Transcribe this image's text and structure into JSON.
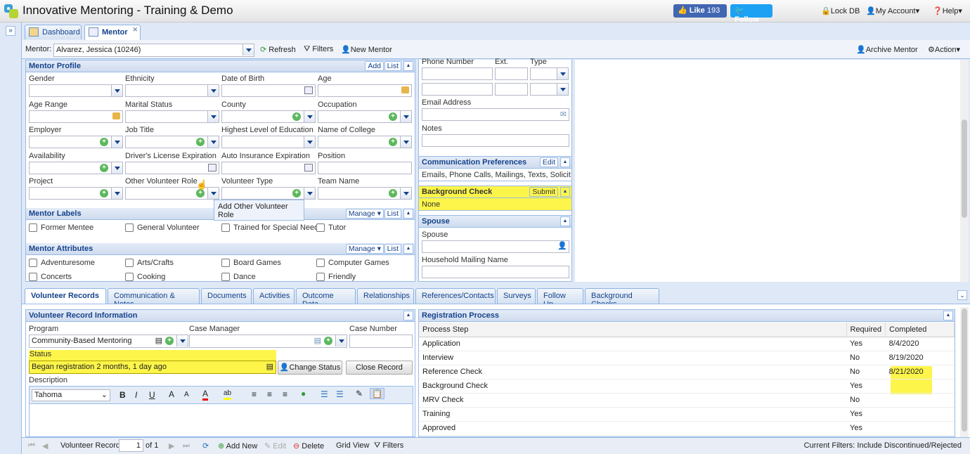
{
  "app": {
    "title": "Innovative Mentoring - Training & Demo"
  },
  "header": {
    "like_label": "Like",
    "like_count": "193",
    "follow_label": "Follow",
    "lock_db": "Lock DB",
    "my_account": "My Account",
    "help": "Help"
  },
  "tabs": [
    {
      "label": "Dashboard"
    },
    {
      "label": "Mentor"
    }
  ],
  "toolbar": {
    "mentor_label": "Mentor:",
    "mentor_value": "Alvarez, Jessica (10246)",
    "refresh": "Refresh",
    "filters": "Filters",
    "new_mentor": "New Mentor",
    "archive": "Archive Mentor",
    "action": "Action"
  },
  "profile": {
    "title": "Mentor Profile",
    "add": "Add",
    "list": "List",
    "fields": [
      {
        "label": "Gender",
        "type": "select"
      },
      {
        "label": "Ethnicity",
        "type": "select"
      },
      {
        "label": "Date of Birth",
        "type": "date"
      },
      {
        "label": "Age",
        "type": "lock"
      },
      {
        "label": "Age Range",
        "type": "lock"
      },
      {
        "label": "Marital Status",
        "type": "select"
      },
      {
        "label": "County",
        "type": "plus"
      },
      {
        "label": "Occupation",
        "type": "plus"
      },
      {
        "label": "Employer",
        "type": "plus"
      },
      {
        "label": "Job Title",
        "type": "plus"
      },
      {
        "label": "Highest Level of Education",
        "type": "select"
      },
      {
        "label": "Name of College",
        "type": "plus"
      },
      {
        "label": "Availability",
        "type": "plus"
      },
      {
        "label": "Driver's License Expiration",
        "type": "date"
      },
      {
        "label": "Auto Insurance Expiration",
        "type": "date"
      },
      {
        "label": "Position",
        "type": "text"
      },
      {
        "label": "Project",
        "type": "plus"
      },
      {
        "label": "Other Volunteer Role",
        "type": "plus"
      },
      {
        "label": "Volunteer Type",
        "type": "plus"
      },
      {
        "label": "Team Name",
        "type": "plus"
      }
    ],
    "tooltip": "Add Other Volunteer Role"
  },
  "labels": {
    "title": "Mentor Labels",
    "manage": "Manage",
    "list": "List",
    "items": [
      "Former Mentee",
      "General Volunteer",
      "Trained for Special Needs",
      "Tutor"
    ]
  },
  "attributes": {
    "title": "Mentor Attributes",
    "manage": "Manage",
    "list": "List",
    "items": [
      "Adventuresome",
      "Arts/Crafts",
      "Board Games",
      "Computer Games",
      "Concerts",
      "Cooking",
      "Dance",
      "Friendly"
    ]
  },
  "contact": {
    "phone": "Phone Number",
    "ext": "Ext.",
    "type": "Type",
    "email": "Email Address",
    "notes": "Notes"
  },
  "comm_prefs": {
    "title": "Communication Preferences",
    "edit": "Edit",
    "value": "Emails, Phone Calls, Mailings, Texts, Solicit"
  },
  "background": {
    "title": "Background Check",
    "submit": "Submit",
    "value": "None"
  },
  "spouse": {
    "title": "Spouse",
    "spouse_label": "Spouse",
    "household": "Household Mailing Name"
  },
  "bottom_tabs": [
    "Volunteer Records",
    "Communication & Notes",
    "Documents",
    "Activities",
    "Outcome Data",
    "Relationships",
    "References/Contacts",
    "Surveys",
    "Follow Up",
    "Background Checks"
  ],
  "record": {
    "title": "Volunteer Record Information",
    "program_label": "Program",
    "program_value": "Community-Based Mentoring",
    "case_manager_label": "Case Manager",
    "case_number_label": "Case Number",
    "status_label": "Status",
    "status_value": "Began registration 2 months, 1 day ago",
    "change_status": "Change Status",
    "close_record": "Close Record",
    "description_label": "Description",
    "font": "Tahoma"
  },
  "registration": {
    "title": "Registration Process",
    "columns": [
      "Process Step",
      "Required",
      "Completed"
    ],
    "rows": [
      [
        "Application",
        "Yes",
        "8/4/2020"
      ],
      [
        "Interview",
        "No",
        "8/19/2020"
      ],
      [
        "Reference Check",
        "No",
        "8/21/2020"
      ],
      [
        "Background Check",
        "Yes",
        ""
      ],
      [
        "MRV Check",
        "No",
        ""
      ],
      [
        "Training",
        "Yes",
        ""
      ],
      [
        "Approved",
        "Yes",
        ""
      ]
    ]
  },
  "bottombar": {
    "record_label": "Volunteer Record",
    "page": "1",
    "of": "of 1",
    "add_new": "Add New",
    "edit": "Edit",
    "delete": "Delete",
    "grid_view": "Grid View",
    "filters": "Filters",
    "current_filters": "Current Filters: Include Discontinued/Rejected"
  },
  "colors": {
    "facebook": "#4267b2",
    "twitter": "#1da1f2",
    "highlight": "#fdf54a",
    "header_text": "#15428b"
  }
}
